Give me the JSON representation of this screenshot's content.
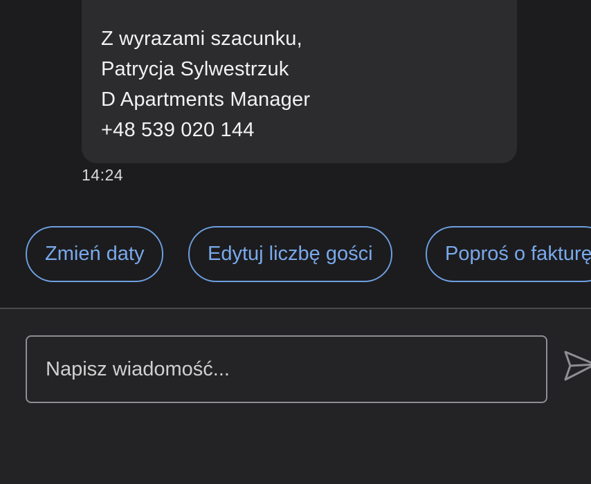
{
  "message": {
    "lines": [
      "Z wyrazami szacunku,",
      "Patrycja Sylwestrzuk",
      "D Apartments Manager",
      "+48 539 020 144"
    ],
    "time": "14:24"
  },
  "quick_actions": [
    {
      "label": "Zmień daty"
    },
    {
      "label": "Edytuj liczbę gości"
    },
    {
      "label": "Poproś o fakturę"
    }
  ],
  "composer": {
    "placeholder": "Napisz wiadomość...",
    "send_icon": "send-icon"
  },
  "colors": {
    "background": "#1c1c1e",
    "bubble": "#2c2c2e",
    "accent": "#7aa9ec"
  }
}
